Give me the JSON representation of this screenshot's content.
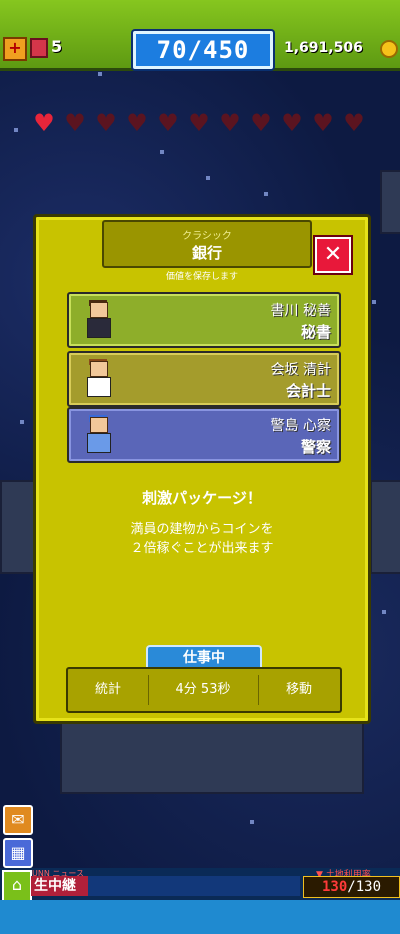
{
  "header": {
    "book_count": "5",
    "population": "70/450",
    "coins": "1,691,506"
  },
  "hearts": {
    "filled": 1,
    "total": 11
  },
  "dialog": {
    "category": "クラシック",
    "title": "銀行",
    "close_label": "✕",
    "subtitle": "価値を保存します",
    "workers": [
      {
        "name": "書川 秘善",
        "role": "秘書"
      },
      {
        "name": "会坂 清計",
        "role": "会計士"
      },
      {
        "name": "警島 心察",
        "role": "警察"
      }
    ],
    "bonus_title": "刺激パッケージ！",
    "bonus_line1": "満員の建物からコインを",
    "bonus_line2": "２倍稼ぐことが出来ます",
    "status_tab": "仕事中",
    "stats_label": "統計",
    "timer": "4分 53秒",
    "move_label": "移動"
  },
  "news": {
    "tag": "UNN ニュース",
    "live_label": "生中継",
    "fill_label": "▼ 土地利用率",
    "fill_current": "130",
    "fill_max": "/130"
  },
  "colors": {
    "dialog_bg": "#c8c300",
    "topbar": "#86c61f",
    "close": "#e8183a",
    "status_tab": "#2a8ad8"
  }
}
